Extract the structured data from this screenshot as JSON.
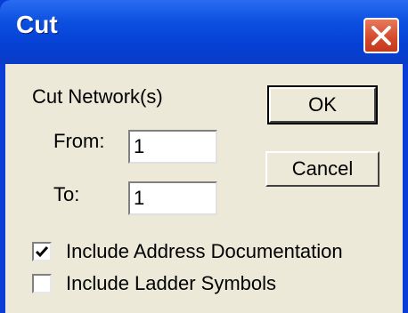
{
  "window": {
    "title": "Cut"
  },
  "group": {
    "label": "Cut Network(s)"
  },
  "from": {
    "label": "From:",
    "value": "1"
  },
  "to": {
    "label": "To:",
    "value": "1"
  },
  "buttons": {
    "ok": "OK",
    "cancel": "Cancel"
  },
  "options": [
    {
      "label": "Include Address Documentation",
      "checked": true
    },
    {
      "label": "Include Ladder Symbols",
      "checked": false
    }
  ],
  "colors": {
    "titlebar": "#0540d4",
    "client": "#ece9d8",
    "close": "#d4482a"
  },
  "icons": {
    "close": "close-icon",
    "check": "check-icon"
  }
}
